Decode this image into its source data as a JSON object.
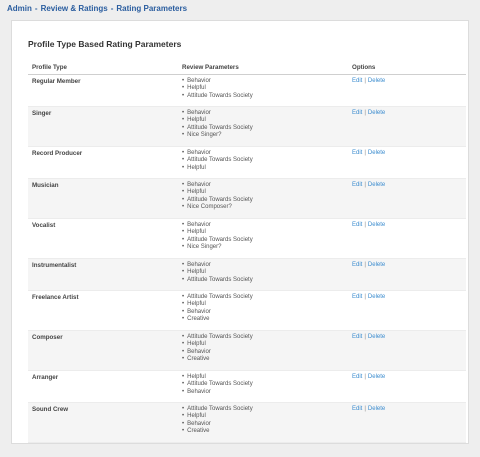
{
  "breadcrumb": {
    "items": [
      "Admin",
      "Review & Ratings",
      "Rating Parameters"
    ],
    "separator": "-"
  },
  "panel": {
    "title": "Profile Type Based Rating Parameters"
  },
  "table": {
    "headers": [
      "Profile Type",
      "Review Parameters",
      "Options"
    ],
    "edit_label": "Edit",
    "option_separator": "|",
    "delete_label": "Delete",
    "rows": [
      {
        "type": "Regular Member",
        "params": [
          "Behavior",
          "Helpful",
          "Attitude Towards Society"
        ]
      },
      {
        "type": "Singer",
        "params": [
          "Behavior",
          "Helpful",
          "Attitude Towards Society",
          "Nice Singer?"
        ]
      },
      {
        "type": "Record Producer",
        "params": [
          "Behavior",
          "Attitude Towards Society",
          "Helpful"
        ]
      },
      {
        "type": "Musician",
        "params": [
          "Behavior",
          "Helpful",
          "Attitude Towards Society",
          "Nice Composer?"
        ]
      },
      {
        "type": "Vocalist",
        "params": [
          "Behavior",
          "Helpful",
          "Attitude Towards Society",
          "Nice Singer?"
        ]
      },
      {
        "type": "Instrumentalist",
        "params": [
          "Behavior",
          "Helpful",
          "Attitude Towards Society"
        ]
      },
      {
        "type": "Freelance Artist",
        "params": [
          "Attitude Towards Society",
          "Helpful",
          "Behavior",
          "Creative"
        ]
      },
      {
        "type": "Composer",
        "params": [
          "Attitude Towards Society",
          "Helpful",
          "Behavior",
          "Creative"
        ]
      },
      {
        "type": "Arranger",
        "params": [
          "Helpful",
          "Attitude Towards Society",
          "Behavior"
        ]
      },
      {
        "type": "Sound Crew",
        "params": [
          "Attitude Towards Society",
          "Helpful",
          "Behavior",
          "Creative"
        ]
      }
    ]
  }
}
